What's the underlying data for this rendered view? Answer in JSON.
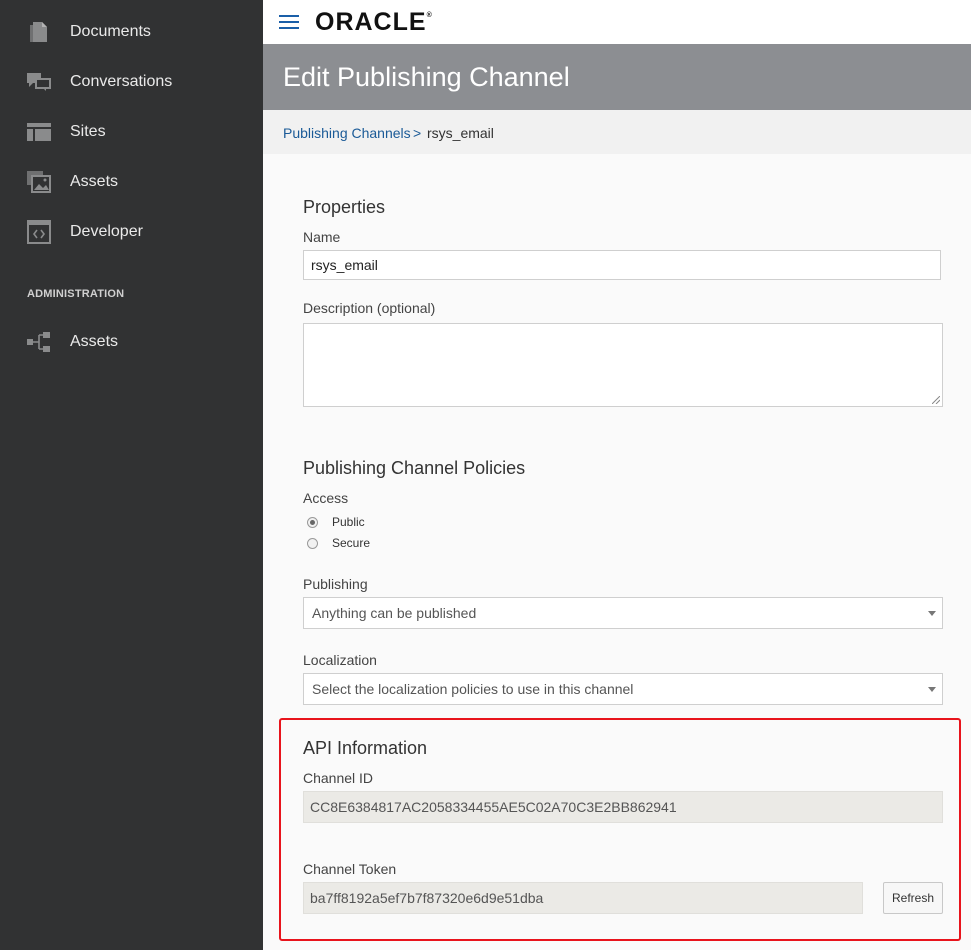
{
  "sidebar": {
    "items": [
      {
        "label": "Documents",
        "icon": "document-icon"
      },
      {
        "label": "Conversations",
        "icon": "conversations-icon"
      },
      {
        "label": "Sites",
        "icon": "sites-icon"
      },
      {
        "label": "Assets",
        "icon": "assets-icon"
      },
      {
        "label": "Developer",
        "icon": "developer-icon"
      }
    ],
    "admin_heading": "ADMINISTRATION",
    "admin_items": [
      {
        "label": "Assets",
        "icon": "asset-tree-icon"
      }
    ]
  },
  "header": {
    "logo": "ORACLE",
    "logo_mark": "®",
    "menu_icon": "hamburger-icon"
  },
  "page": {
    "title": "Edit Publishing Channel"
  },
  "breadcrumb": {
    "parent": "Publishing Channels",
    "separator": ">",
    "current": "rsys_email"
  },
  "properties": {
    "heading": "Properties",
    "name_label": "Name",
    "name_value": "rsys_email",
    "description_label": "Description (optional)",
    "description_value": ""
  },
  "policies": {
    "heading": "Publishing Channel Policies",
    "access_label": "Access",
    "access_options": [
      {
        "label": "Public",
        "selected": true
      },
      {
        "label": "Secure",
        "selected": false
      }
    ],
    "publishing_label": "Publishing",
    "publishing_value": "Anything can be published",
    "localization_label": "Localization",
    "localization_placeholder": "Select the localization policies to use in this channel"
  },
  "api": {
    "heading": "API Information",
    "channel_id_label": "Channel ID",
    "channel_id_value": "CC8E6384817AC2058334455AE5C02A70C3E2BB862941",
    "channel_token_label": "Channel Token",
    "channel_token_value": "ba7ff8192a5ef7b7f87320e6d9e51dba",
    "refresh_label": "Refresh"
  },
  "colors": {
    "sidebar_bg": "#313233",
    "title_band": "#8c8e92",
    "link": "#1a5a97",
    "highlight": "#e8141c"
  }
}
